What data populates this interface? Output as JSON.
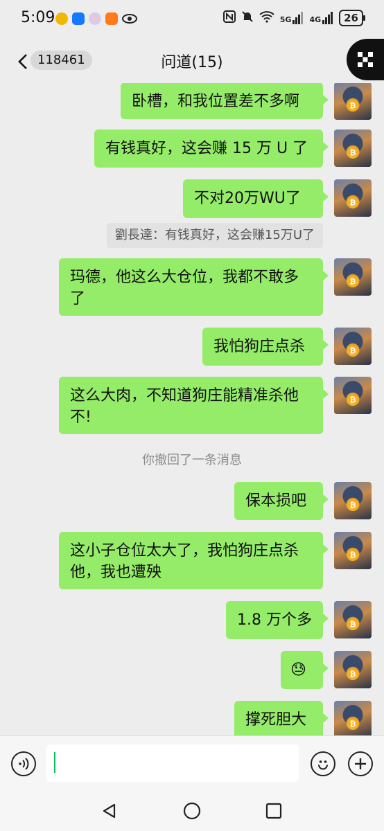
{
  "status_bar": {
    "time": "5:09",
    "network_5g": "5G",
    "network_4g": "4G",
    "battery": "26"
  },
  "header": {
    "unread_count": "118461",
    "title": "问道(15)"
  },
  "messages": [
    "卧槽，和我位置差不多啊",
    "有钱真好，这会赚 15 万 U 了",
    "不对20万WU了",
    "玛德，他这么大仓位，我都不敢多了",
    "我怕狗庄点杀",
    "这么大肉，不知道狗庄能精准杀他不!",
    "保本损吧",
    "这小子仓位太大了，我怕狗庄点杀他，我也遭殃",
    "1.8 万个多",
    "😓",
    "撑死胆大"
  ],
  "quote": "劉長達：有钱真好，这会赚15万U了",
  "system_note": "你撤回了一条消息",
  "input": {
    "value": ""
  },
  "colors": {
    "bubble": "#95ec69",
    "background": "#ededed",
    "accent": "#07c160"
  }
}
